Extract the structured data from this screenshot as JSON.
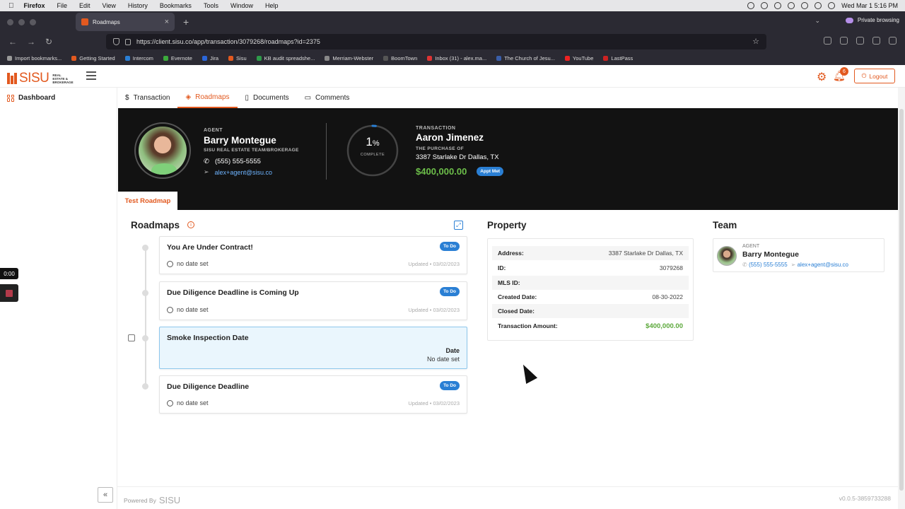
{
  "mac_menu": {
    "app": "Firefox",
    "items": [
      "File",
      "Edit",
      "View",
      "History",
      "Bookmarks",
      "Tools",
      "Window",
      "Help"
    ],
    "datetime": "Wed Mar 1  5:16 PM"
  },
  "browser": {
    "tab_title": "Roadmaps",
    "private_label": "Private browsing",
    "url": "https://client.sisu.co/app/transaction/3079268/roadmaps?id=2375",
    "bookmarks": [
      "Import bookmarks...",
      "Getting Started",
      "Intercom",
      "Evernote",
      "Jira",
      "Sisu",
      "KB audit spreadshe...",
      "Merriam-Webster",
      "BoomTown",
      "Inbox (31) - alex.ma...",
      "The Church of Jesu...",
      "YouTube",
      "LastPass"
    ]
  },
  "header": {
    "logo_text": "SISU",
    "logo_sub": "REAL ESTATE & BROKERAGE",
    "notification_count": "6",
    "logout_label": "Logout"
  },
  "sidebar": {
    "dashboard_label": "Dashboard",
    "timer": "0:00",
    "collapse_label": "«"
  },
  "tabs": [
    {
      "label": "Transaction",
      "icon": "dollar-icon"
    },
    {
      "label": "Roadmaps",
      "icon": "roadmap-icon"
    },
    {
      "label": "Documents",
      "icon": "document-icon"
    },
    {
      "label": "Comments",
      "icon": "comment-icon"
    }
  ],
  "hero": {
    "agent_label": "AGENT",
    "agent_name": "Barry Montegue",
    "agent_company": "SISU REAL ESTATE TEAM/BROKERAGE",
    "agent_phone": "(555) 555-5555",
    "agent_email": "alex+agent@sisu.co",
    "progress_value": "1",
    "progress_unit": "%",
    "progress_fraction": 0.01,
    "progress_label": "COMPLETE",
    "transaction_label": "TRANSACTION",
    "client_name": "Aaron Jimenez",
    "purchase_label": "THE PURCHASE OF",
    "address": "3387 Starlake Dr Dallas, TX",
    "amount": "$400,000.00",
    "status_badge": "Appt Met",
    "roadmap_tab": "Test Roadmap"
  },
  "roadmaps": {
    "title": "Roadmaps",
    "items": [
      {
        "title": "You Are Under Contract!",
        "status": "To Do",
        "date": "no date set",
        "updated": "Updated • 03/02/2023"
      },
      {
        "title": "Due Diligence Deadline is Coming Up",
        "status": "To Do",
        "date": "no date set",
        "updated": "Updated • 03/02/2023"
      },
      {
        "title": "Smoke Inspection Date",
        "date_label": "Date",
        "date_value": "No date set"
      },
      {
        "title": "Due Diligence Deadline",
        "status": "To Do",
        "date": "no date set",
        "updated": "Updated • 03/02/2023"
      }
    ]
  },
  "property": {
    "title": "Property",
    "rows": [
      {
        "key": "Address:",
        "value": "3387 Starlake Dr Dallas, TX"
      },
      {
        "key": "ID:",
        "value": "3079268"
      },
      {
        "key": "MLS ID:",
        "value": ""
      },
      {
        "key": "Created Date:",
        "value": "08-30-2022"
      },
      {
        "key": "Closed Date:",
        "value": ""
      },
      {
        "key": "Transaction Amount:",
        "value": "$400,000.00"
      }
    ]
  },
  "team": {
    "title": "Team",
    "role": "AGENT",
    "name": "Barry Montegue",
    "phone": "(555) 555-5555",
    "email": "alex+agent@sisu.co"
  },
  "footer": {
    "powered_by": "Powered By",
    "brand": "SISU",
    "version": "v0.0.5-3859733288"
  },
  "colors": {
    "accent": "#e2591f",
    "link": "#2a7fd4",
    "money": "#6dbf4a",
    "hero_bg": "#121212"
  }
}
